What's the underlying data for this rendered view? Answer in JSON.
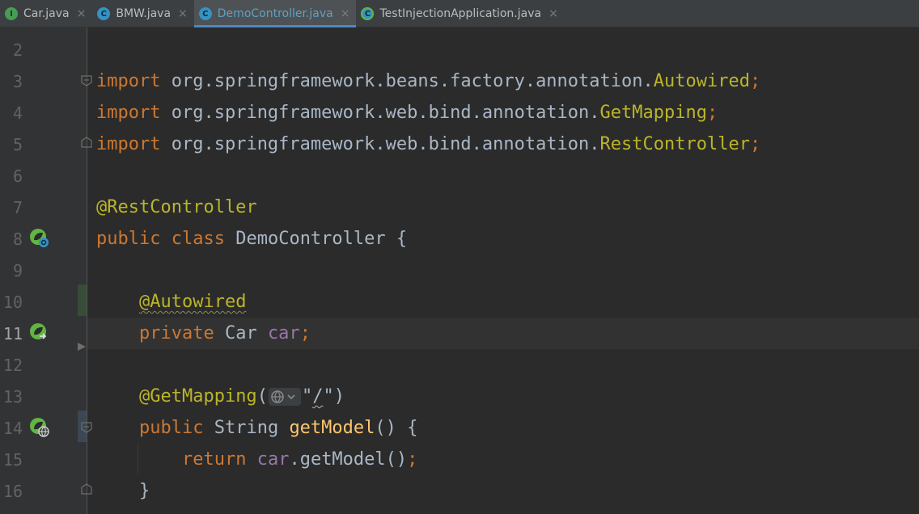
{
  "tabs": [
    {
      "label": "Car.java",
      "icon": "interface-file-icon",
      "badge": "I",
      "active": false
    },
    {
      "label": "BMW.java",
      "icon": "class-file-icon",
      "badge": "C",
      "active": false
    },
    {
      "label": "DemoController.java",
      "icon": "class-file-icon",
      "badge": "C",
      "active": true
    },
    {
      "label": "TestInjectionApplication.java",
      "icon": "spring-app-file-icon",
      "badge": "C",
      "active": false
    }
  ],
  "close_glyph": "×",
  "editor": {
    "current_line": 11,
    "lines": [
      {
        "n": "2"
      },
      {
        "n": "3",
        "kw": "import",
        "pkg": " org.springframework.beans.factory.annotation.",
        "cls": "Autowired",
        "semi": ";"
      },
      {
        "n": "4",
        "kw": "import",
        "pkg": " org.springframework.web.bind.annotation.",
        "cls": "GetMapping",
        "semi": ";"
      },
      {
        "n": "5",
        "kw": "import",
        "pkg": " org.springframework.web.bind.annotation.",
        "cls": "RestController",
        "semi": ";"
      },
      {
        "n": "6"
      },
      {
        "n": "7",
        "ann": "@RestController"
      },
      {
        "n": "8",
        "kw1": "public",
        "kw2": "class",
        "name": "DemoController",
        "brace": " {"
      },
      {
        "n": "9"
      },
      {
        "n": "10",
        "indent": "    ",
        "ann": "@Autowired"
      },
      {
        "n": "11",
        "indent": "    ",
        "kw": "private",
        "type": " Car ",
        "field": "car",
        "semi": ";"
      },
      {
        "n": "12"
      },
      {
        "n": "13",
        "indent": "    ",
        "ann": "@GetMapping",
        "open": "(",
        "str_open": "\"",
        "str_val": "/",
        "str_close": "\"",
        "close": ")"
      },
      {
        "n": "14",
        "indent": "    ",
        "kw": "public",
        "type": " String ",
        "method": "getModel",
        "rest": "() {"
      },
      {
        "n": "15",
        "indent": "        ",
        "kw": "return",
        "sp": " ",
        "field": "car",
        "call": ".getModel()",
        "semi": ";"
      },
      {
        "n": "16",
        "indent": "    ",
        "brace": "}"
      }
    ]
  },
  "colors": {
    "background": "#2b2b2b",
    "gutter": "#313335",
    "keyword": "#cc7832",
    "annotation": "#bbb529",
    "field": "#9876aa",
    "method": "#ffc66d",
    "string": "#6a8759",
    "text": "#a9b7c6",
    "active_tab_text": "#5fa0c6",
    "active_tab_underline": "#4a88c7"
  }
}
